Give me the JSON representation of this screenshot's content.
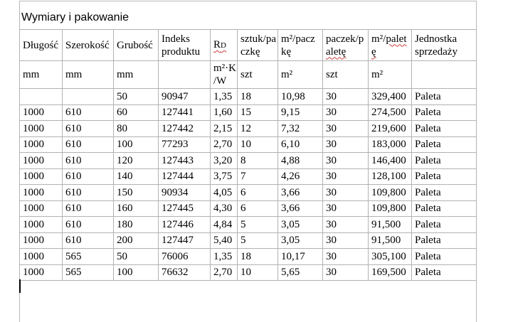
{
  "title": "Wymiary i pakowanie",
  "colors": {
    "table_border": "#b2b2b2",
    "boundary_line": "#b8b8b8",
    "spellcheck_underline": "#cc3b3b",
    "text": "#000000",
    "background": "#ffffff"
  },
  "table": {
    "header": [
      {
        "lines": [
          [
            {
              "t": "Długość"
            }
          ]
        ]
      },
      {
        "lines": [
          [
            {
              "t": "Szerokość"
            }
          ]
        ]
      },
      {
        "lines": [
          [
            {
              "t": "Grubość"
            }
          ]
        ]
      },
      {
        "lines": [
          [
            {
              "t": "Indeks"
            }
          ],
          [
            {
              "t": "produktu"
            }
          ]
        ]
      },
      {
        "lines": [
          [
            {
              "t": "R",
              "sq": true
            },
            {
              "t": "D",
              "sq": true,
              "small": true
            }
          ]
        ]
      },
      {
        "lines": [
          [
            {
              "t": "sztuk/pa"
            }
          ],
          [
            {
              "t": "czkę"
            }
          ]
        ]
      },
      {
        "lines": [
          [
            {
              "t": "m²/pacz"
            }
          ],
          [
            {
              "t": "kę"
            }
          ]
        ]
      },
      {
        "lines": [
          [
            {
              "t": "paczek/p"
            }
          ],
          [
            {
              "t": "aletę",
              "sq": true
            }
          ]
        ]
      },
      {
        "lines": [
          [
            {
              "t": "m²/"
            },
            {
              "t": "palet",
              "sq": true
            }
          ],
          [
            {
              "t": "ę",
              "sq": true
            }
          ]
        ]
      },
      {
        "lines": [
          [
            {
              "t": "Jednostka"
            }
          ],
          [
            {
              "t": "sprzedaży"
            }
          ]
        ]
      }
    ],
    "units": [
      [
        "mm"
      ],
      [
        "mm"
      ],
      [
        "mm"
      ],
      [],
      [
        "m²·K",
        "/W"
      ],
      [
        "szt"
      ],
      [
        "m²"
      ],
      [
        "szt"
      ],
      [
        "m²"
      ],
      []
    ],
    "rows": [
      [
        "",
        "",
        "50",
        "90947",
        "1,35",
        "18",
        "10,98",
        "30",
        "329,400",
        "Paleta"
      ],
      [
        "1000",
        "610",
        "60",
        "127441",
        "1,60",
        "15",
        "9,15",
        "30",
        "274,500",
        "Paleta"
      ],
      [
        "1000",
        "610",
        "80",
        "127442",
        "2,15",
        "12",
        "7,32",
        "30",
        "219,600",
        "Paleta"
      ],
      [
        "1000",
        "610",
        "100",
        "77293",
        "2,70",
        "10",
        "6,10",
        "30",
        "183,000",
        "Paleta"
      ],
      [
        "1000",
        "610",
        "120",
        "127443",
        "3,20",
        "8",
        "4,88",
        "30",
        "146,400",
        "Paleta"
      ],
      [
        "1000",
        "610",
        "140",
        "127444",
        "3,75",
        "7",
        "4,26",
        "30",
        "128,100",
        "Paleta"
      ],
      [
        "1000",
        "610",
        "150",
        "90934",
        "4,05",
        "6",
        "3,66",
        "30",
        "109,800",
        "Paleta"
      ],
      [
        "1000",
        "610",
        "160",
        "127445",
        "4,30",
        "6",
        "3,66",
        "30",
        "109,800",
        "Paleta"
      ],
      [
        "1000",
        "610",
        "180",
        "127446",
        "4,84",
        "5",
        "3,05",
        "30",
        "91,500",
        "Paleta"
      ],
      [
        "1000",
        "610",
        "200",
        "127447",
        "5,40",
        "5",
        "3,05",
        "30",
        "91,500",
        "Paleta"
      ],
      [
        "1000",
        "565",
        "50",
        "76006",
        "1,35",
        "18",
        "10,17",
        "30",
        "305,100",
        "Paleta"
      ],
      [
        "1000",
        "565",
        "100",
        "76632",
        "2,70",
        "10",
        "5,65",
        "30",
        "169,500",
        "Paleta"
      ]
    ]
  }
}
